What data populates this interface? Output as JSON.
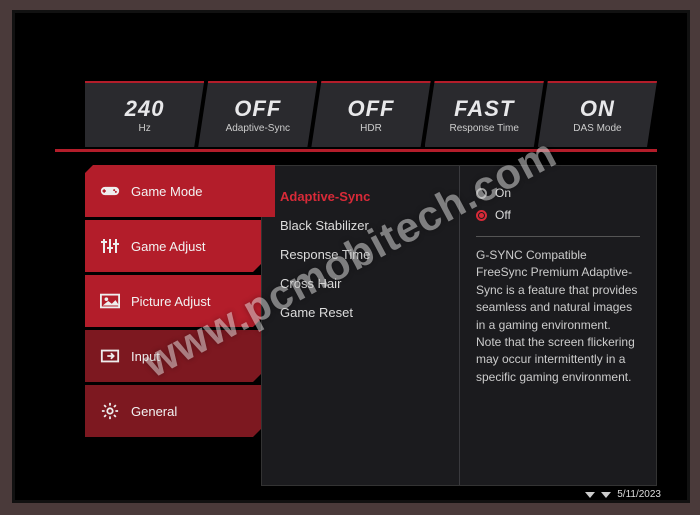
{
  "status": [
    {
      "value": "240",
      "label": "Hz"
    },
    {
      "value": "OFF",
      "label": "Adaptive-Sync"
    },
    {
      "value": "OFF",
      "label": "HDR"
    },
    {
      "value": "FAST",
      "label": "Response Time"
    },
    {
      "value": "ON",
      "label": "DAS Mode"
    }
  ],
  "sidebar": {
    "items": [
      {
        "label": "Game Mode"
      },
      {
        "label": "Game Adjust"
      },
      {
        "label": "Picture Adjust"
      },
      {
        "label": "Input"
      },
      {
        "label": "General"
      }
    ]
  },
  "submenu": {
    "items": [
      {
        "label": "Adaptive-Sync",
        "selected": true
      },
      {
        "label": "Black Stabilizer"
      },
      {
        "label": "Response Time"
      },
      {
        "label": "Cross Hair"
      },
      {
        "label": "Game Reset"
      }
    ]
  },
  "options": {
    "on": "On",
    "off": "Off"
  },
  "description": "G-SYNC Compatible FreeSync Premium Adaptive-Sync is a feature that provides seamless and natural images in a gaming environment.\nNote that the screen flickering may occur intermittently in a specific gaming environment.",
  "footer": {
    "date": "5/11/2023"
  },
  "watermark": "www.pcmobitech.com"
}
